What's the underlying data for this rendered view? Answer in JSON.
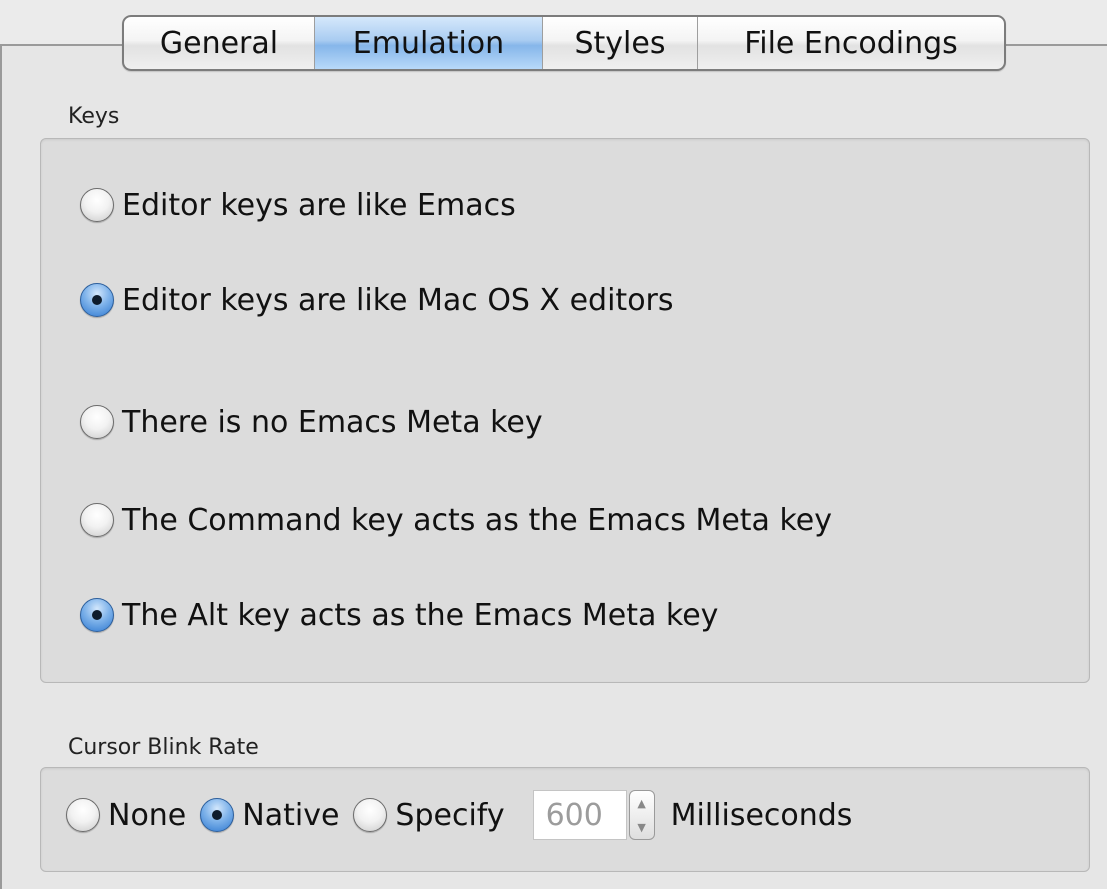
{
  "tabs": [
    {
      "label": "General",
      "selected": false
    },
    {
      "label": "Emulation",
      "selected": true
    },
    {
      "label": "Styles",
      "selected": false
    },
    {
      "label": "File Encodings",
      "selected": false
    }
  ],
  "keys_group": {
    "title": "Keys",
    "options": [
      {
        "label": "Editor keys are like Emacs",
        "checked": false
      },
      {
        "label": "Editor keys are like Mac OS X editors",
        "checked": true
      },
      {
        "label": "There is no Emacs Meta key",
        "checked": false
      },
      {
        "label": "The Command key acts as the Emacs Meta key",
        "checked": false
      },
      {
        "label": "The Alt key acts as the Emacs Meta key",
        "checked": true
      }
    ]
  },
  "cursor_blink_group": {
    "title": "Cursor Blink Rate",
    "options": [
      {
        "label": "None",
        "checked": false
      },
      {
        "label": "Native",
        "checked": true
      },
      {
        "label": "Specify",
        "checked": false
      }
    ],
    "value": "600",
    "unit_label": "Milliseconds"
  },
  "icons": {
    "stepper_up": "▲",
    "stepper_down": "▼"
  },
  "colors": {
    "selected_tab": "#a9ccf1",
    "radio_checked": "#2f79d1"
  }
}
